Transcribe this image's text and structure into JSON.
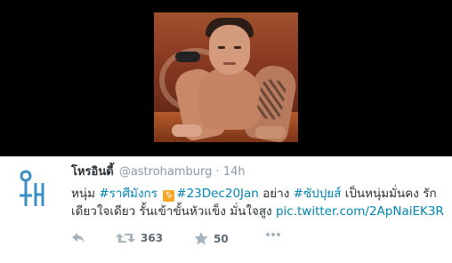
{
  "tweet": {
    "display_name": "โหรอินดี้",
    "handle": "@astrohamburg",
    "separator": "·",
    "time": "14h",
    "line1": {
      "pre": "หนุ่ม ",
      "hashtag1": "#ราศีมังกร",
      "hashtag2": "#23Dec20Jan",
      "mid": " อย่าง ",
      "hashtag3": "#ซัปปุยส์",
      "post": " เป็นหนุ่มมั่นคง รัก"
    },
    "line2": {
      "text": "เดียวใจเดียว รั้นเข้าขั้นหัวแข็ง มั่นใจสูง ",
      "link": "pic.twitter.com/2ApNaiEK3R"
    },
    "emoji_icon": "capricorn-emoji",
    "actions": {
      "retweet_count": "363",
      "favorite_count": "50"
    }
  },
  "colors": {
    "link": "#0084b4",
    "text": "#292f33",
    "muted": "#8899a6",
    "avatar": "#3b8fc4"
  }
}
